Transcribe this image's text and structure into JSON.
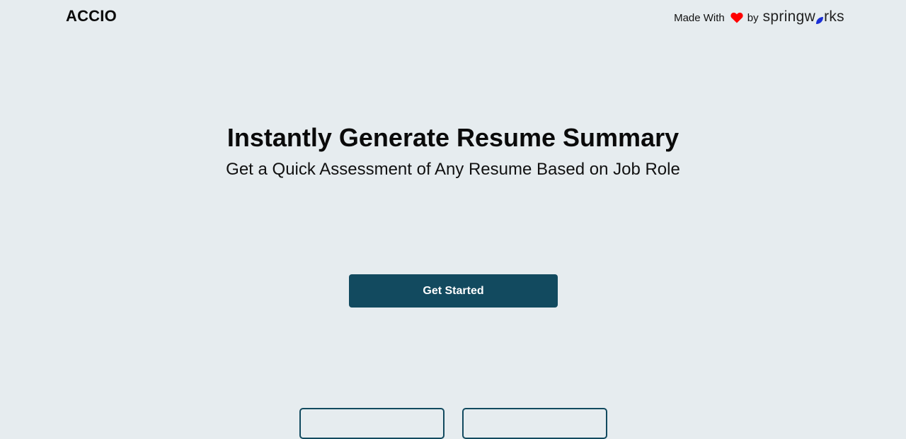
{
  "header": {
    "brand": "ACCIO",
    "made_with": "Made With",
    "by": "by",
    "springworks_prefix": "springw",
    "springworks_suffix": "rks",
    "heart_color": "#ff0000",
    "leaf_color": "#1a2fd6"
  },
  "hero": {
    "title": "Instantly Generate Resume Summary",
    "subtitle": "Get a Quick Assessment of Any Resume Based on Job Role"
  },
  "cta": {
    "label": "Get Started",
    "color": "#124a5f"
  },
  "cards": [
    {
      "id": "card-1"
    },
    {
      "id": "card-2"
    }
  ]
}
